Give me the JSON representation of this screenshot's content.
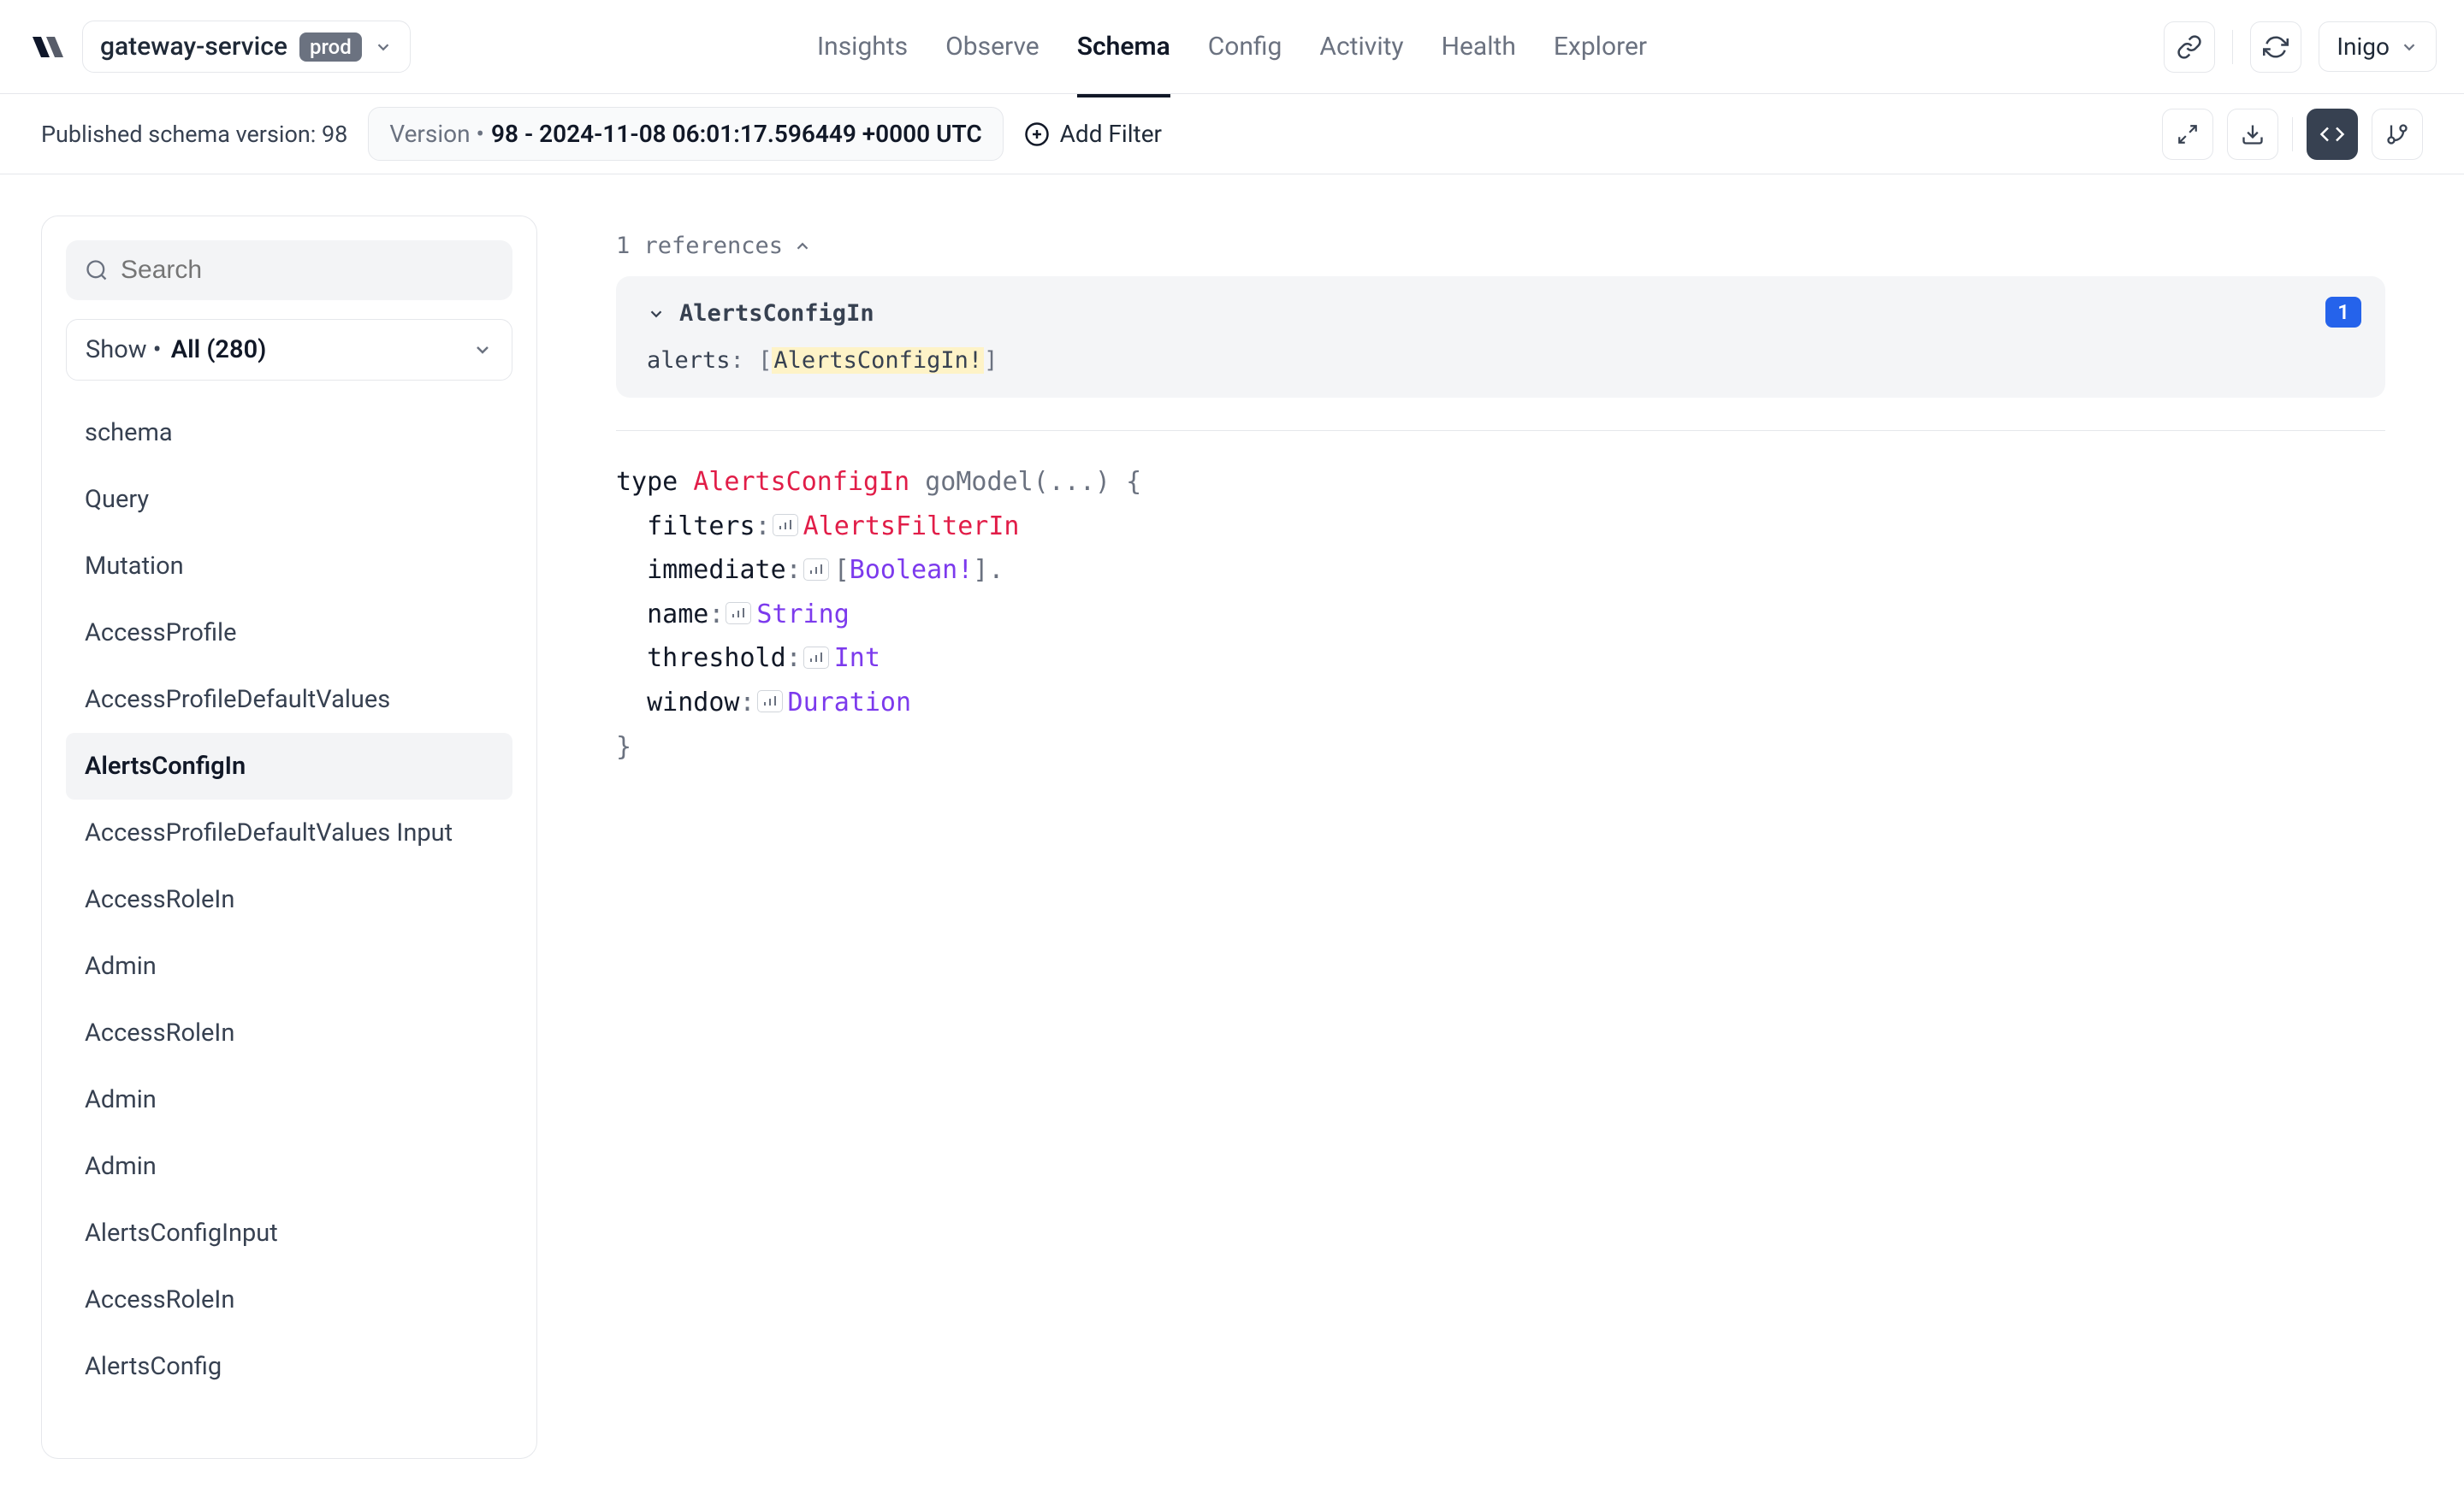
{
  "header": {
    "service_name": "gateway-service",
    "env_badge": "prod",
    "nav": [
      "Insights",
      "Observe",
      "Schema",
      "Config",
      "Activity",
      "Health",
      "Explorer"
    ],
    "active_nav": "Schema",
    "user": "Inigo"
  },
  "subheader": {
    "published_label": "Published schema version: 98",
    "version_label": "Version •",
    "version_value": "98 - 2024-11-08 06:01:17.596449 +0000 UTC",
    "add_filter": "Add Filter"
  },
  "sidebar": {
    "search_placeholder": "Search",
    "show_label": "Show •",
    "show_value": "All (280)",
    "items": [
      "schema",
      "Query",
      "Mutation",
      "AccessProfile",
      "AccessProfileDefaultValues",
      "AlertsConfigIn",
      "AccessProfileDefaultValues Input",
      "AccessRoleIn",
      "Admin",
      "AccessRoleIn",
      "Admin",
      "Admin",
      "AlertsConfigInput",
      "AccessRoleIn",
      "AlertsConfig"
    ],
    "selected_index": 5
  },
  "main": {
    "references_label": "1 references",
    "reference": {
      "title": "AlertsConfigIn",
      "field_name": "alerts",
      "field_type_prefix": "[",
      "field_type_highlight": "AlertsConfigIn!",
      "field_type_suffix": "]",
      "count": "1"
    },
    "schema": {
      "keyword": "type",
      "typename": "AlertsConfigIn",
      "directive": "goModel(...)",
      "open": "{",
      "close": "}",
      "fields": [
        {
          "name": "filters",
          "type": "AlertsFilterIn",
          "type_class": "typename",
          "suffix": ""
        },
        {
          "name": "immediate",
          "type": "Boolean!",
          "type_class": "fieldtype",
          "prefix": "[",
          "suffix": "]."
        },
        {
          "name": "name",
          "type": "String",
          "type_class": "fieldtype",
          "suffix": ""
        },
        {
          "name": "threshold",
          "type": "Int",
          "type_class": "fieldtype",
          "suffix": ""
        },
        {
          "name": "window",
          "type": "Duration",
          "type_class": "fieldtype",
          "suffix": ""
        }
      ]
    }
  }
}
